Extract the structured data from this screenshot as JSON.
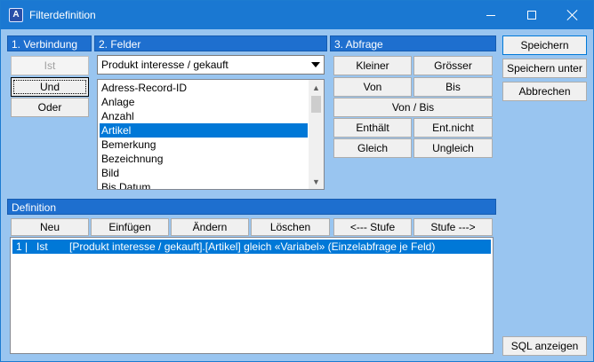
{
  "window": {
    "title": "Filterdefinition",
    "icon_letter": "A"
  },
  "verbindung": {
    "header": "1. Verbindung",
    "buttons": [
      "Ist",
      "Und",
      "Oder"
    ]
  },
  "felder": {
    "header": "2. Felder",
    "combo_value": "Produkt interesse / gekauft",
    "items": [
      "Adress-Record-ID",
      "Anlage",
      "Anzahl",
      "Artikel",
      "Bemerkung",
      "Bezeichnung",
      "Bild",
      "Bis Datum"
    ],
    "selected_index": 3
  },
  "abfrage": {
    "header": "3. Abfrage",
    "kleiner": "Kleiner",
    "groesser": "Grösser",
    "von": "Von",
    "bis": "Bis",
    "von_bis": "Von / Bis",
    "enthaelt": "Enthält",
    "ent_nicht": "Ent.nicht",
    "gleich": "Gleich",
    "ungleich": "Ungleich"
  },
  "actions": {
    "speichern": "Speichern",
    "speichern_unter": "Speichern unter",
    "abbrechen": "Abbrechen",
    "sql_anzeigen": "SQL anzeigen"
  },
  "definition": {
    "header": "Definition",
    "toolbar": [
      "Neu",
      "Einfügen",
      "Ändern",
      "Löschen",
      "<--- Stufe",
      "Stufe --->"
    ],
    "rows": [
      {
        "num": "1 |",
        "conn": "Ist",
        "expr": "[Produkt interesse / gekauft].[Artikel]  gleich  «Variabel» (Einzelabfrage je Feld)"
      }
    ]
  },
  "colors": {
    "titlebar": "#1a78d2",
    "background": "#99c5f0",
    "section_header": "#1e6fcf",
    "selection": "#0078d7"
  }
}
